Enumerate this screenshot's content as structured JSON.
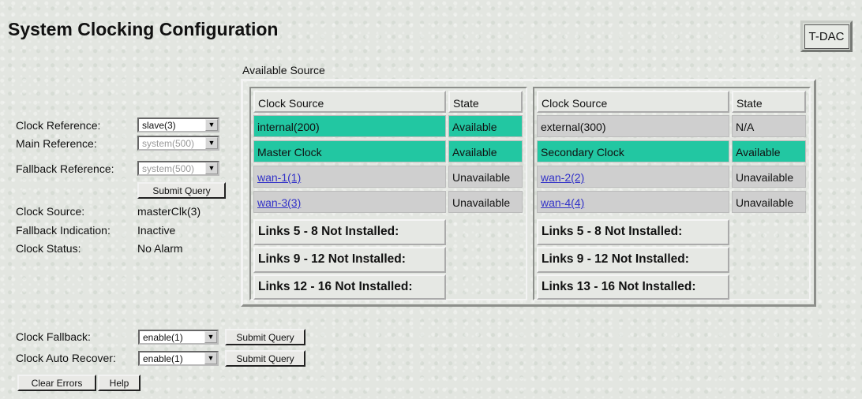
{
  "page": {
    "title": "System Clocking Configuration",
    "badge": "T-DAC"
  },
  "form": {
    "clock_reference": {
      "label": "Clock Reference:",
      "value": "slave(3)"
    },
    "main_reference": {
      "label": "Main Reference:",
      "value": "system(500)"
    },
    "fallback_reference": {
      "label": "Fallback Reference:",
      "value": "system(500)"
    },
    "submit_label": "Submit Query",
    "clock_source": {
      "label": "Clock Source:",
      "value": "masterClk(3)"
    },
    "fallback_indication": {
      "label": "Fallback Indication:",
      "value": "Inactive"
    },
    "clock_status": {
      "label": "Clock Status:",
      "value": "No Alarm"
    }
  },
  "available_source": {
    "label": "Available Source",
    "headers": [
      "Clock Source",
      "State"
    ],
    "left": {
      "rows": [
        {
          "source": "internal(200)",
          "state": "Available"
        },
        {
          "source": "Master Clock",
          "state": "Available"
        },
        {
          "source": "wan-1(1)",
          "state": "Unavailable"
        },
        {
          "source": "wan-3(3)",
          "state": "Unavailable"
        }
      ],
      "notes": [
        "Links 5 - 8 Not Installed:",
        "Links 9 - 12 Not Installed:",
        "Links 12 - 16 Not Installed:"
      ]
    },
    "right": {
      "rows": [
        {
          "source": "external(300)",
          "state": "N/A"
        },
        {
          "source": "Secondary Clock",
          "state": "Available"
        },
        {
          "source": "wan-2(2)",
          "state": "Unavailable"
        },
        {
          "source": "wan-4(4)",
          "state": "Unavailable"
        }
      ],
      "notes": [
        "Links 5 - 8 Not Installed:",
        "Links 9 - 12 Not Installed:",
        "Links 13 - 16 Not Installed:"
      ]
    }
  },
  "bottom": {
    "clock_fallback": {
      "label": "Clock Fallback:",
      "value": "enable(1)"
    },
    "clock_auto_recover": {
      "label": "Clock Auto Recover:",
      "value": "enable(1)"
    },
    "submit_label": "Submit Query",
    "clear_errors_label": "Clear Errors",
    "help_label": "Help"
  },
  "colors": {
    "available": "#22c7a2",
    "unavailable": "#cfcfcf",
    "link": "#3232c8"
  }
}
